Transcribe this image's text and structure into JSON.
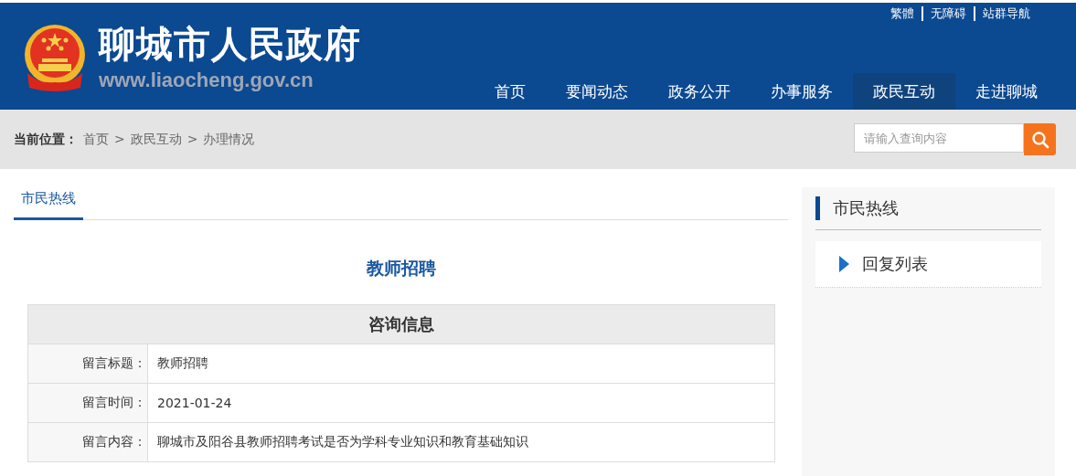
{
  "site": {
    "title": "聊城市人民政府",
    "url": "www.liaocheng.gov.cn"
  },
  "top_links": [
    "繁體",
    "无障碍",
    "站群导航"
  ],
  "nav": [
    {
      "label": "首页",
      "selected": false
    },
    {
      "label": "要闻动态",
      "selected": false
    },
    {
      "label": "政务公开",
      "selected": false
    },
    {
      "label": "办事服务",
      "selected": false
    },
    {
      "label": "政民互动",
      "selected": true
    },
    {
      "label": "走进聊城",
      "selected": false
    }
  ],
  "breadcrumb": {
    "label": "当前位置：",
    "path": [
      "首页",
      ">",
      "政民互动",
      ">",
      "办理情况"
    ]
  },
  "search": {
    "placeholder": "请输入查询内容"
  },
  "tabs": [
    {
      "label": "市民热线",
      "selected": true
    }
  ],
  "article": {
    "title": "教师招聘",
    "table_title": "咨询信息",
    "rows": [
      {
        "label": "留言标题：",
        "value": "教师招聘"
      },
      {
        "label": "留言时间：",
        "value": "2021-01-24"
      },
      {
        "label": "留言内容：",
        "value": "聊城市及阳谷县教师招聘考试是否为学科专业知识和教育基础知识"
      }
    ]
  },
  "sidebar": {
    "title": "市民热线",
    "items": [
      "回复列表"
    ]
  }
}
